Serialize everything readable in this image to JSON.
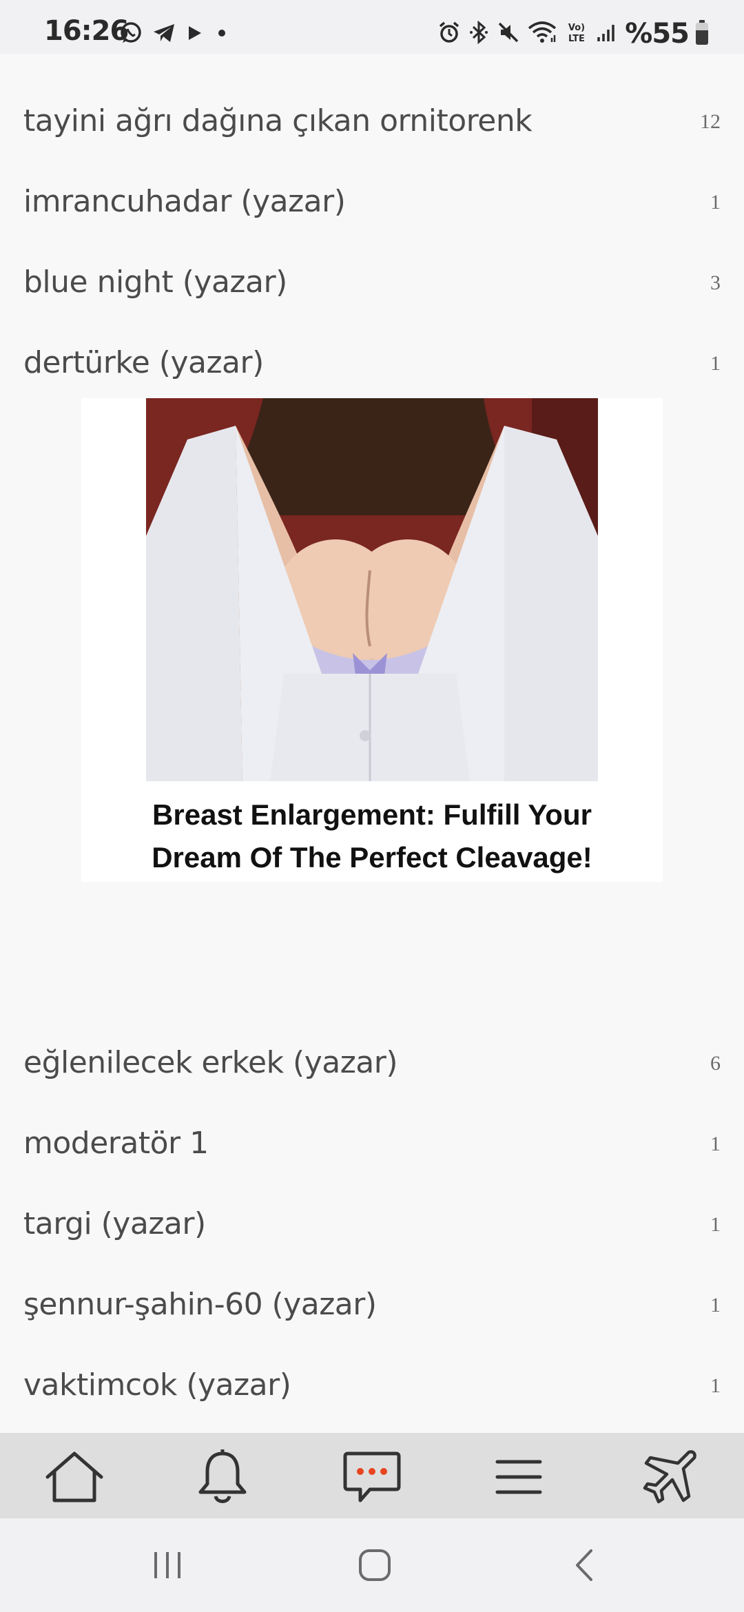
{
  "status_bar": {
    "time": "16:26",
    "battery": "%55",
    "left_icons": [
      "whatsapp-icon",
      "telegram-icon",
      "play-icon",
      "dot-icon"
    ],
    "right_icons": [
      "alarm-icon",
      "bluetooth-icon",
      "mute-icon",
      "wifi-icon",
      "volte-icon",
      "signal-icon",
      "battery-icon"
    ]
  },
  "list": {
    "items_top": [
      {
        "title": "tayini ağrı dağına çıkan ornitorenk",
        "count": "12"
      },
      {
        "title": "imrancuhadar (yazar)",
        "count": "1"
      },
      {
        "title": "blue night (yazar)",
        "count": "3"
      },
      {
        "title": "dertürke (yazar)",
        "count": "1"
      }
    ],
    "items_bottom": [
      {
        "title": "eğlenilecek erkek (yazar)",
        "count": "6"
      },
      {
        "title": "moderatör 1",
        "count": "1"
      },
      {
        "title": "targi (yazar)",
        "count": "1"
      },
      {
        "title": "şennur-şahin-60 (yazar)",
        "count": "1"
      },
      {
        "title": "vaktimcok (yazar)",
        "count": "1"
      }
    ]
  },
  "ad": {
    "caption_line1": "Breast Enlargement: Fulfill Your",
    "caption_line2": "Dream Of The Perfect Cleavage!"
  },
  "bottom_nav": {
    "items": [
      "home-icon",
      "bell-icon",
      "messages-icon",
      "menu-icon",
      "plane-icon"
    ],
    "accent": "#e8441e"
  },
  "system_nav": {
    "items": [
      "recent-apps-icon",
      "home-circle-icon",
      "back-icon"
    ]
  }
}
